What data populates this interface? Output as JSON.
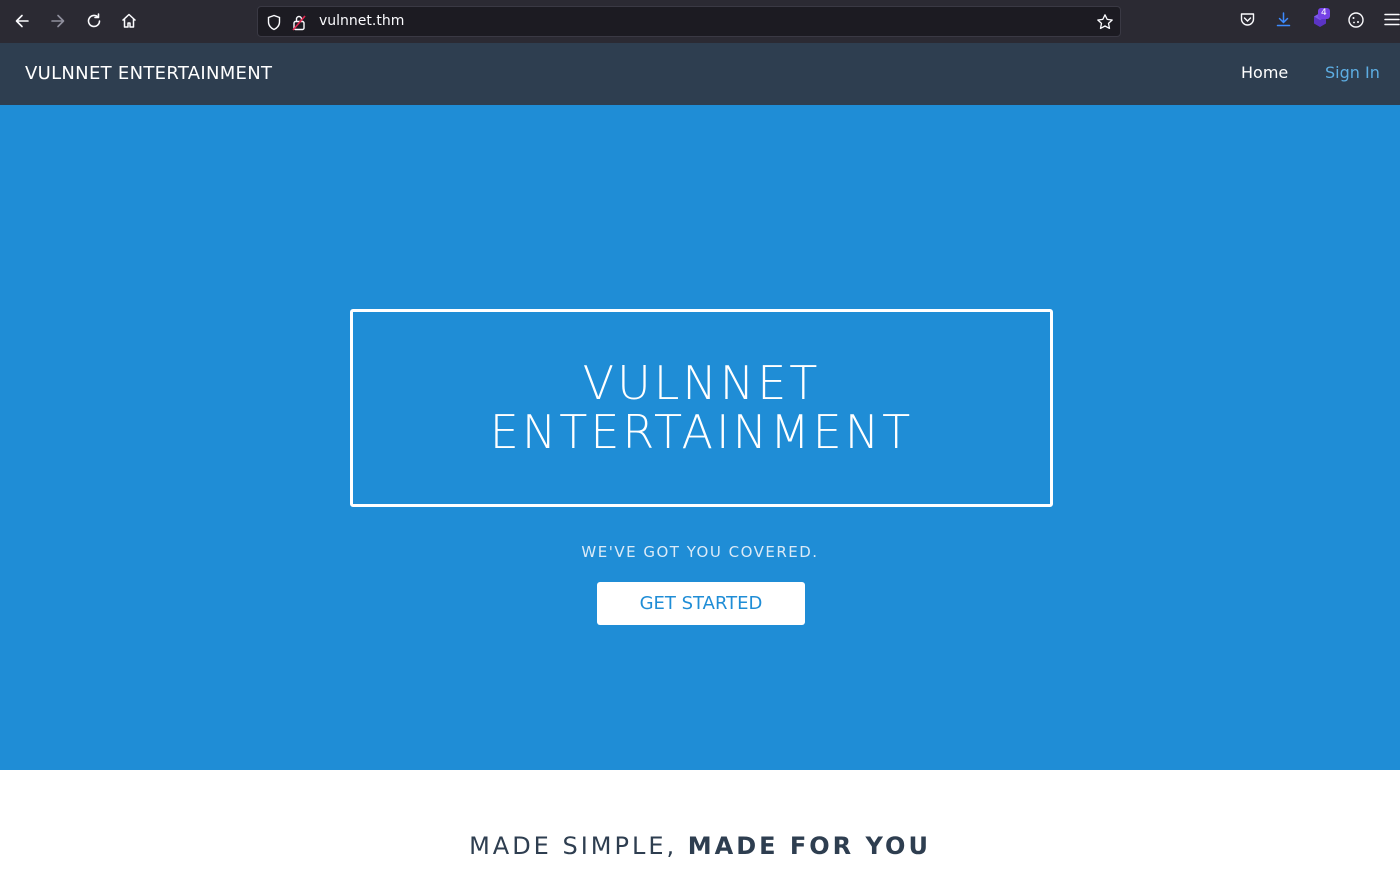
{
  "browser": {
    "url": "vulnnet.thm",
    "extension_badge": "4",
    "icons": [
      "back-icon",
      "forward-icon",
      "reload-icon",
      "home-icon",
      "shield-icon",
      "lock-icon",
      "star-icon",
      "pocket-icon",
      "download-icon",
      "extension-icon",
      "cookie-icon",
      "menu-icon"
    ]
  },
  "nav": {
    "brand": "VULNNET ENTERTAINMENT",
    "home": "Home",
    "signin": "Sign In"
  },
  "hero": {
    "title_line1": "VULNNET",
    "title_line2": "ENTERTAINMENT",
    "tagline": "WE'VE GOT YOU COVERED.",
    "cta": "GET STARTED"
  },
  "section": {
    "heading_light": "MADE SIMPLE, ",
    "heading_bold": "MADE FOR YOU"
  },
  "colors": {
    "hero_bg": "#1f8dd6",
    "nav_bg": "#2e3e50",
    "link_accent": "#5dade2",
    "chrome_bg": "#2b2a33"
  }
}
